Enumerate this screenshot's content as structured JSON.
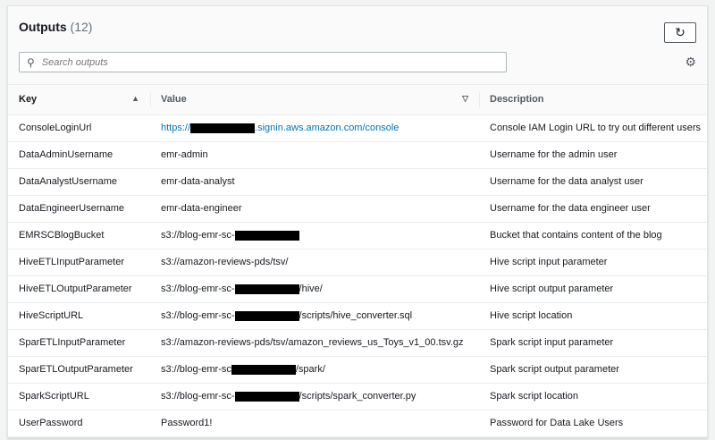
{
  "header": {
    "title": "Outputs",
    "count": "(12)",
    "search_placeholder": "Search outputs"
  },
  "columns": {
    "key": "Key",
    "value": "Value",
    "description": "Description",
    "key_sort": "▲",
    "value_sort": "▽"
  },
  "rows": [
    {
      "key": "ConsoleLoginUrl",
      "prefix": "https://",
      "redacted": true,
      "suffix": ".signin.aws.amazon.com/console",
      "link": true,
      "desc": "Console IAM Login URL to try out different users"
    },
    {
      "key": "DataAdminUsername",
      "prefix": "emr-admin",
      "redacted": false,
      "suffix": "",
      "desc": "Username for the admin user"
    },
    {
      "key": "DataAnalystUsername",
      "prefix": "emr-data-analyst",
      "redacted": false,
      "suffix": "",
      "desc": "Username for the data analyst user"
    },
    {
      "key": "DataEngineerUsername",
      "prefix": "emr-data-engineer",
      "redacted": false,
      "suffix": "",
      "desc": "Username for the data engineer user"
    },
    {
      "key": "EMRSCBlogBucket",
      "prefix": "s3://blog-emr-sc-",
      "redacted": true,
      "suffix": "",
      "desc": "Bucket that contains content of the blog"
    },
    {
      "key": "HiveETLInputParameter",
      "prefix": "s3://amazon-reviews-pds/tsv/",
      "redacted": false,
      "suffix": "",
      "desc": "Hive script input parameter"
    },
    {
      "key": "HiveETLOutputParameter",
      "prefix": "s3://blog-emr-sc-",
      "redacted": true,
      "suffix": "/hive/",
      "desc": "Hive script output parameter"
    },
    {
      "key": "HiveScriptURL",
      "prefix": "s3://blog-emr-sc-",
      "redacted": true,
      "suffix": "/scripts/hive_converter.sql",
      "desc": "Hive script location"
    },
    {
      "key": "SparETLInputParameter",
      "prefix": "s3://amazon-reviews-pds/tsv/amazon_reviews_us_Toys_v1_00.tsv.gz",
      "redacted": false,
      "suffix": "",
      "desc": "Spark script input parameter"
    },
    {
      "key": "SparETLOutputParameter",
      "prefix": "s3://blog-emr-sc",
      "redacted": true,
      "suffix": "/spark/",
      "desc": "Spark script output parameter"
    },
    {
      "key": "SparkScriptURL",
      "prefix": "s3://blog-emr-sc-",
      "redacted": true,
      "suffix": "/scripts/spark_converter.py",
      "desc": "Spark script location"
    },
    {
      "key": "UserPassword",
      "prefix": "Password1!",
      "redacted": false,
      "suffix": "",
      "desc": "Password for Data Lake Users"
    }
  ]
}
